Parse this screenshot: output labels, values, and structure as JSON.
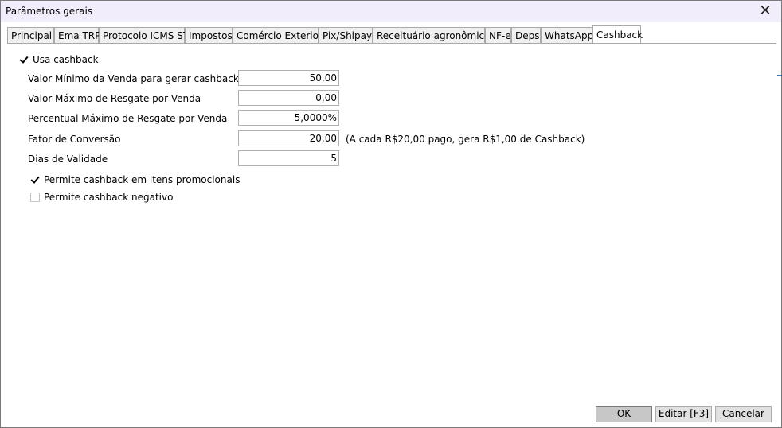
{
  "window": {
    "title": "Parâmetros gerais",
    "close_glyph": "✕"
  },
  "tabs": [
    {
      "label": "Principal"
    },
    {
      "label": "Ema TRP"
    },
    {
      "label": "Protocolo ICMS ST"
    },
    {
      "label": "Impostos"
    },
    {
      "label": "Comércio Exterior"
    },
    {
      "label": "Pix/Shipay"
    },
    {
      "label": "Receituário agronômico"
    },
    {
      "label": "NF-e"
    },
    {
      "label": "Deps"
    },
    {
      "label": "WhatsApp"
    },
    {
      "label": "Cashback"
    }
  ],
  "active_tab": "Cashback",
  "cashback": {
    "enable_label": "Usa cashback",
    "enable_checked": true,
    "fields": [
      {
        "label": "Valor Mínimo da Venda para gerar cashback",
        "value": "50,00"
      },
      {
        "label": "Valor Máximo de Resgate por Venda",
        "value": "0,00"
      },
      {
        "label": "Percentual Máximo de Resgate por Venda",
        "value": "5,0000%"
      },
      {
        "label": "Fator de Conversão",
        "value": "20,00"
      },
      {
        "label": "Dias de Validade",
        "value": "5"
      }
    ],
    "conversion_hint": "(A cada R$20,00 pago, gera R$1,00 de Cashback)",
    "promo_label": "Permite cashback em itens promocionais",
    "promo_checked": true,
    "negative_label": "Permite cashback negativo",
    "negative_checked": false
  },
  "buttons": {
    "ok_mnemonic": "O",
    "ok_rest": "K",
    "edit_mnemonic": "E",
    "edit_rest": "ditar [F3]",
    "cancel_mnemonic": "C",
    "cancel_rest": "ancelar"
  }
}
